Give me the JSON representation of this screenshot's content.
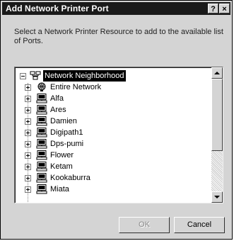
{
  "window": {
    "title": "Add Network Printer Port",
    "help_label": "?",
    "close_label": "×"
  },
  "instructions": "Select a Network Printer Resource to add to the available list of Ports.",
  "tree": {
    "root": {
      "label": "Network Neighborhood",
      "icon": "network-neighborhood-icon",
      "expander": "collapse"
    },
    "items": [
      {
        "label": "Entire Network",
        "icon": "globe-icon"
      },
      {
        "label": "Alfa",
        "icon": "computer-icon"
      },
      {
        "label": "Ares",
        "icon": "computer-icon"
      },
      {
        "label": "Damien",
        "icon": "computer-icon"
      },
      {
        "label": "Digipath1",
        "icon": "computer-icon"
      },
      {
        "label": "Dps-pumi",
        "icon": "computer-icon"
      },
      {
        "label": "Flower",
        "icon": "computer-icon"
      },
      {
        "label": "Ketam",
        "icon": "computer-icon"
      },
      {
        "label": "Kookaburra",
        "icon": "computer-icon"
      },
      {
        "label": "Miata",
        "icon": "computer-icon"
      }
    ]
  },
  "buttons": {
    "ok_label": "OK",
    "cancel_label": "Cancel"
  },
  "colors": {
    "titlebar": "#1a1a1a",
    "dialog": "#d4d4d4",
    "selection": "#000000"
  }
}
